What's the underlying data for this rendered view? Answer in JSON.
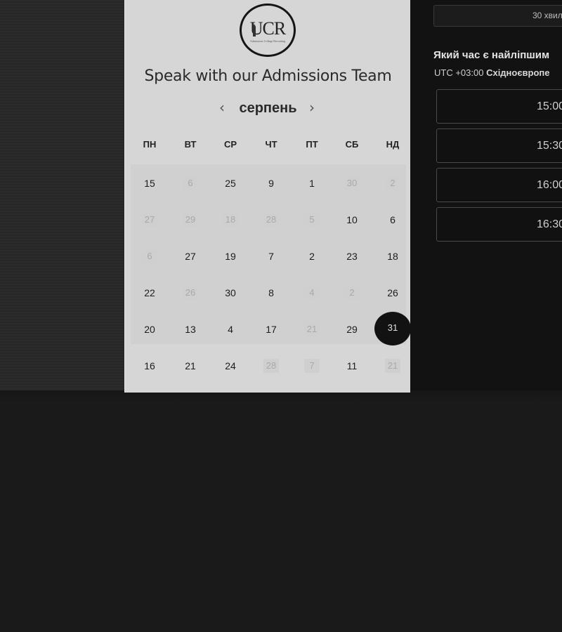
{
  "calendar": {
    "logo_text": "UCR",
    "logo_subtitle": "Admissions College Recruiting",
    "title": "Speak with our Admissions Team",
    "month": "серпень",
    "prev_icon": "‹",
    "next_icon": "›",
    "weekdays": [
      "ПН",
      "ВТ",
      "СР",
      "ЧТ",
      "ПТ",
      "СБ",
      "НД"
    ],
    "rows": [
      [
        {
          "d": "15"
        },
        {
          "d": "6",
          "dim": true
        },
        {
          "d": "25"
        },
        {
          "d": "9"
        },
        {
          "d": "1"
        },
        {
          "d": "30",
          "dim": true
        },
        {
          "d": "2",
          "dim": true
        }
      ],
      [
        {
          "d": "27",
          "dim": true
        },
        {
          "d": "29",
          "dim": true
        },
        {
          "d": "18",
          "dim": true
        },
        {
          "d": "28",
          "dim": true
        },
        {
          "d": "5",
          "dim": true
        },
        {
          "d": "10"
        },
        {
          "d": "6"
        }
      ],
      [
        {
          "d": "6",
          "dim": true
        },
        {
          "d": "27"
        },
        {
          "d": "19"
        },
        {
          "d": "7"
        },
        {
          "d": "2"
        },
        {
          "d": "23"
        },
        {
          "d": "18"
        }
      ],
      [
        {
          "d": "22"
        },
        {
          "d": "26",
          "dim": true
        },
        {
          "d": "30"
        },
        {
          "d": "8"
        },
        {
          "d": "4",
          "dim": true
        },
        {
          "d": "2",
          "dim": true
        },
        {
          "d": "26"
        }
      ],
      [
        {
          "d": "20"
        },
        {
          "d": "13"
        },
        {
          "d": "4"
        },
        {
          "d": "17"
        },
        {
          "d": "21",
          "dim": true
        },
        {
          "d": "29"
        },
        {
          "d": "31",
          "selected": true
        }
      ],
      [
        {
          "d": "16"
        },
        {
          "d": "21"
        },
        {
          "d": "24"
        },
        {
          "d": "28",
          "dim": true
        },
        {
          "d": "7",
          "dim": true
        },
        {
          "d": "11"
        },
        {
          "d": "21",
          "dim": true
        }
      ]
    ]
  },
  "booking": {
    "duration": "30 хвил",
    "question": "Який час є найліпшим",
    "timezone_prefix": "UTC +03:00 ",
    "timezone_name": "Східноєвропе",
    "slots": [
      "15:00",
      "15:30",
      "16:00",
      "16:30"
    ]
  }
}
